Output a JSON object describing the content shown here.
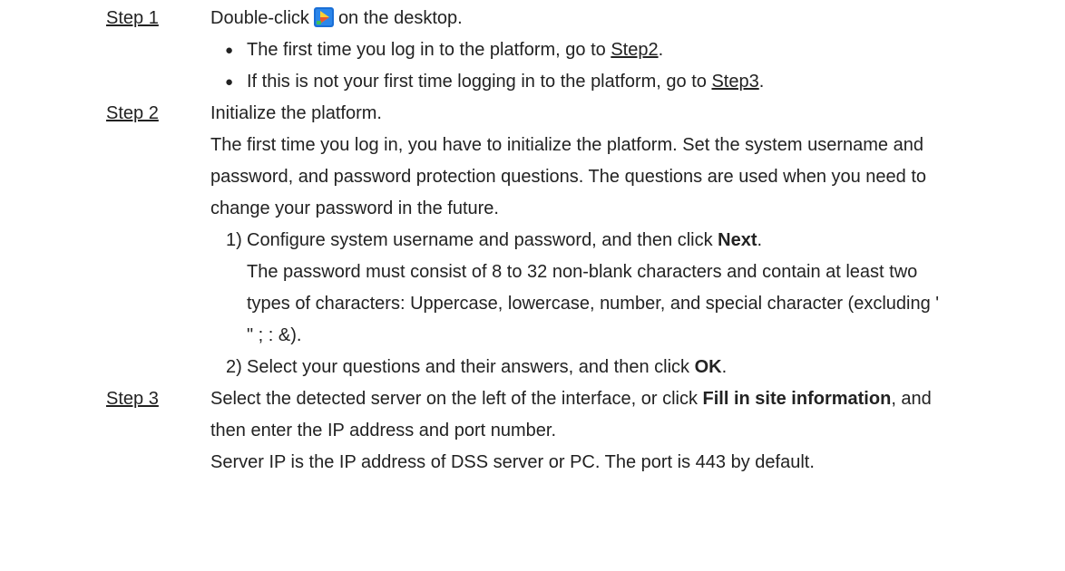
{
  "step1": {
    "label": "Step 1",
    "text_before_icon": "Double-click",
    "icon": "dss-client-app-icon",
    "text_after_icon": "on the desktop.",
    "bullets": [
      {
        "text": "The first time you log in to the platform, go to ",
        "link": "Step2",
        "suffix": "."
      },
      {
        "text": "If this is not your first time logging in to the platform, go to ",
        "link": "Step3",
        "suffix": "."
      }
    ]
  },
  "step2": {
    "label": "Step 2",
    "title": "Initialize the platform.",
    "desc_lines": [
      "The first time you log in, you have to initialize the platform. Set the system username and",
      "password, and password protection questions. The questions are used when you need to",
      "change your password in the future."
    ],
    "sub1": {
      "num": "1)",
      "text": "Configure system username and password, and then click ",
      "bold": "Next",
      "suffix": ".",
      "note_lines": [
        "The password must consist of 8 to 32 non-blank characters and contain at least two",
        "types of characters: Uppercase, lowercase, number, and special character (excluding '",
        "\" ; : &)."
      ]
    },
    "sub2": {
      "num": "2)",
      "text": "Select your questions and their answers, and then click ",
      "bold": "OK",
      "suffix": "."
    }
  },
  "step3": {
    "label": "Step 3",
    "line1_text": "Select the detected server on the left of the interface, or click ",
    "line1_bold": "Fill in site information",
    "line1_suffix": ", and",
    "line2": "then enter the IP address and port number.",
    "line3": "Server IP is the IP address of DSS server or PC. The port is 443 by default."
  },
  "colors": {
    "text": "#222222",
    "icon_bg": "#1a6fd6"
  }
}
